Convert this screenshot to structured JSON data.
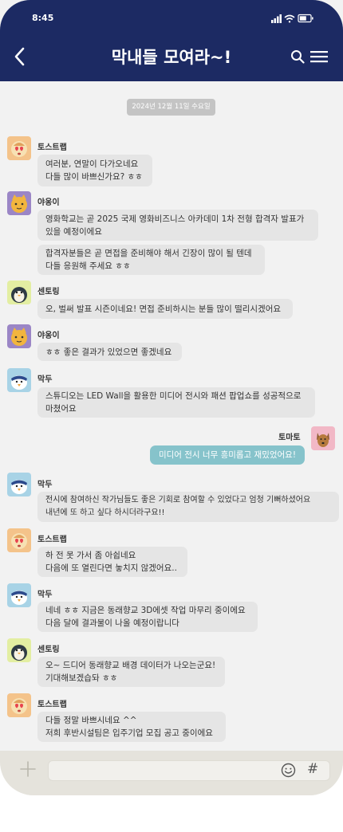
{
  "status_bar": {
    "time": "8:45"
  },
  "header": {
    "title": "막내들 모여라~!"
  },
  "date_badge": "2024년 12월 11일 수요일",
  "messages": [
    {
      "sender": "토스트랩",
      "bubbles": [
        "여러분, 연말이 다가오네요\n다들 많이 바쁘신가요? ㅎㅎ"
      ]
    },
    {
      "sender": "야옹이",
      "bubbles": [
        "영화학교는 곧 2025 국제 영화비즈니스 아카데미 1차 전형 합격자 발표가\n있을 예정이에요",
        "합격자분들은 곧 면접을 준비해야 해서 긴장이 많이 될 텐데\n다들 응원해 주세요 ㅎㅎ"
      ]
    },
    {
      "sender": "센토링",
      "bubbles": [
        "오, 벌써 발표 시즌이네요! 면접 준비하시는 분들 많이 떨리시겠어요"
      ]
    },
    {
      "sender": "야옹이",
      "bubbles": [
        "ㅎㅎ 좋은 결과가 있었으면 좋겠네요"
      ]
    },
    {
      "sender": "막두",
      "bubbles": [
        "스튜디오는 LED Wall을 활용한 미디어 전시와 패션 팝업쇼를 성공적으로\n마쳤어요"
      ]
    },
    {
      "sender": "토마토",
      "mine": true,
      "bubbles": [
        "미디어 전시 너무 흥미롭고 재밌었어요!"
      ]
    },
    {
      "sender": "막두",
      "bubbles": [
        "전시에 참여하신 작가님들도 좋은 기회로 참여할 수 있었다고 엄청 기뻐하셨어요\n내년에 또 하고 싶다 하시더라구요!!"
      ]
    },
    {
      "sender": "토스트랩",
      "bubbles": [
        "하 전 못 가서 좀 아쉽네요\n다음에 또 열린다면 놓치지 않겠어요.."
      ]
    },
    {
      "sender": "막두",
      "bubbles": [
        "네네 ㅎㅎ 지금은 동래향교 3D에셋 작업 마무리 중이에요\n다음 달에 결과물이 나올 예정이랍니다"
      ]
    },
    {
      "sender": "센토링",
      "bubbles": [
        "오~ 드디어 동래향교 배경 데이터가 나오는군요!\n기대해보겠습돠 ㅎㅎ"
      ]
    },
    {
      "sender": "토스트랩",
      "bubbles": [
        "다들 정말 바쁘시네요 ^^\n저희 후반시설팀은 입주기업 모집 공고 중이에요"
      ]
    }
  ],
  "input_bar": {
    "placeholder": ""
  },
  "icons": {
    "back": "chevron-left-icon",
    "search": "search-icon",
    "menu": "hamburger-menu-icon",
    "plus": "plus-icon",
    "emoji": "emoji-icon",
    "hash": "#"
  },
  "colors": {
    "header": "#1c2a63",
    "bubble_other": "#e5e5e5",
    "bubble_mine": "#86c3cb"
  }
}
